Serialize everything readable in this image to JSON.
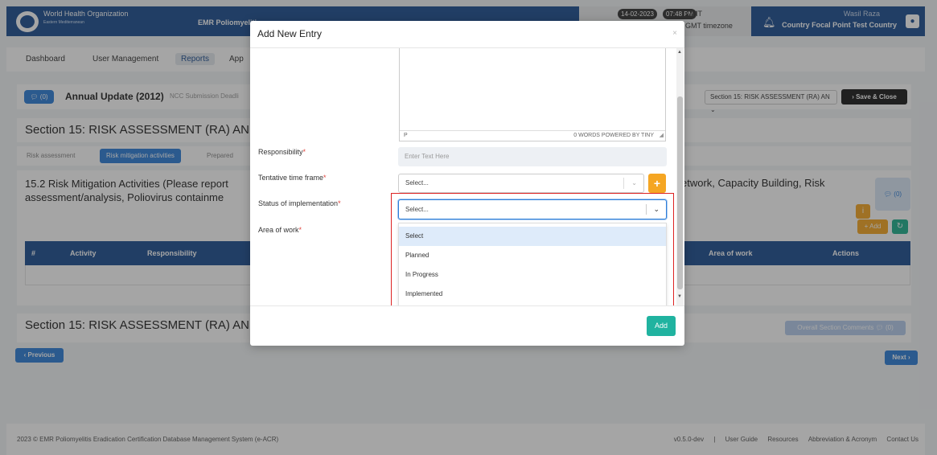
{
  "header": {
    "org_name": "World Health Organization",
    "org_sub": "Eastern Mediterranean",
    "app_name": "EMR Poliomyelitis",
    "date": "14-02-2023",
    "time": "07:48 PM",
    "tz_short": "GMT",
    "tz_long": "GMT timezone",
    "user_name": "Wasil Raza",
    "user_role": "Country Focal Point Test Country"
  },
  "nav": {
    "items": [
      "Dashboard",
      "User Management",
      "Reports",
      "App"
    ],
    "active": "Reports"
  },
  "annual": {
    "badge": "(0)",
    "title": "Annual Update (2012)",
    "note": "NCC Submission Deadli",
    "section_select": "Section 15: RISK ASSESSMENT (RA) AN",
    "save_close": "Save & Close"
  },
  "section": {
    "title": "Section 15: RISK ASSESSMENT (RA) AN"
  },
  "tabs": [
    "Risk assessment",
    "Risk mitigation activities",
    "Prepared"
  ],
  "activities": {
    "title_line1": "15.2 Risk Mitigation Activities (Please report",
    "title_line2": "assessment/analysis, Poliovirus containme",
    "title_right": "etwork, Capacity Building, Risk",
    "comments": "(0)",
    "add": "Add",
    "columns": [
      "#",
      "Activity",
      "Responsibility",
      "Area of work",
      "Actions"
    ]
  },
  "section_foot": {
    "title": "Section 15: RISK ASSESSMENT (RA) AN",
    "overall": "Overall Section Comments",
    "overall_count": "(0)"
  },
  "pager": {
    "prev": "Previous",
    "next": "Next"
  },
  "footer": {
    "left": "2023 © EMR Poliomyelitis Eradication Certification Database Management System (e-ACR)",
    "version": "v0.5.0-dev",
    "links": [
      "User Guide",
      "Resources",
      "Abbreviation & Acronym",
      "Contact Us"
    ]
  },
  "modal": {
    "title": "Add New Entry",
    "close": "×",
    "editor_p": "P",
    "editor_words": "0 WORDS  POWERED BY TINY",
    "responsibility_label": "Responsibility",
    "responsibility_placeholder": "Enter Text Here",
    "timeframe_label": "Tentative time frame",
    "timeframe_value": "Select...",
    "status_label": "Status of implementation",
    "status_value": "Select...",
    "area_label": "Area of work",
    "required_mark": "*",
    "status_options": [
      "Select",
      "Planned",
      "In Progress",
      "Implemented"
    ],
    "add": "Add"
  },
  "colors": {
    "primary": "#1d4f91",
    "accent": "#2d7ed8",
    "warning": "#f5a623",
    "success": "#20b3a0",
    "highlight": "#dd2222"
  }
}
